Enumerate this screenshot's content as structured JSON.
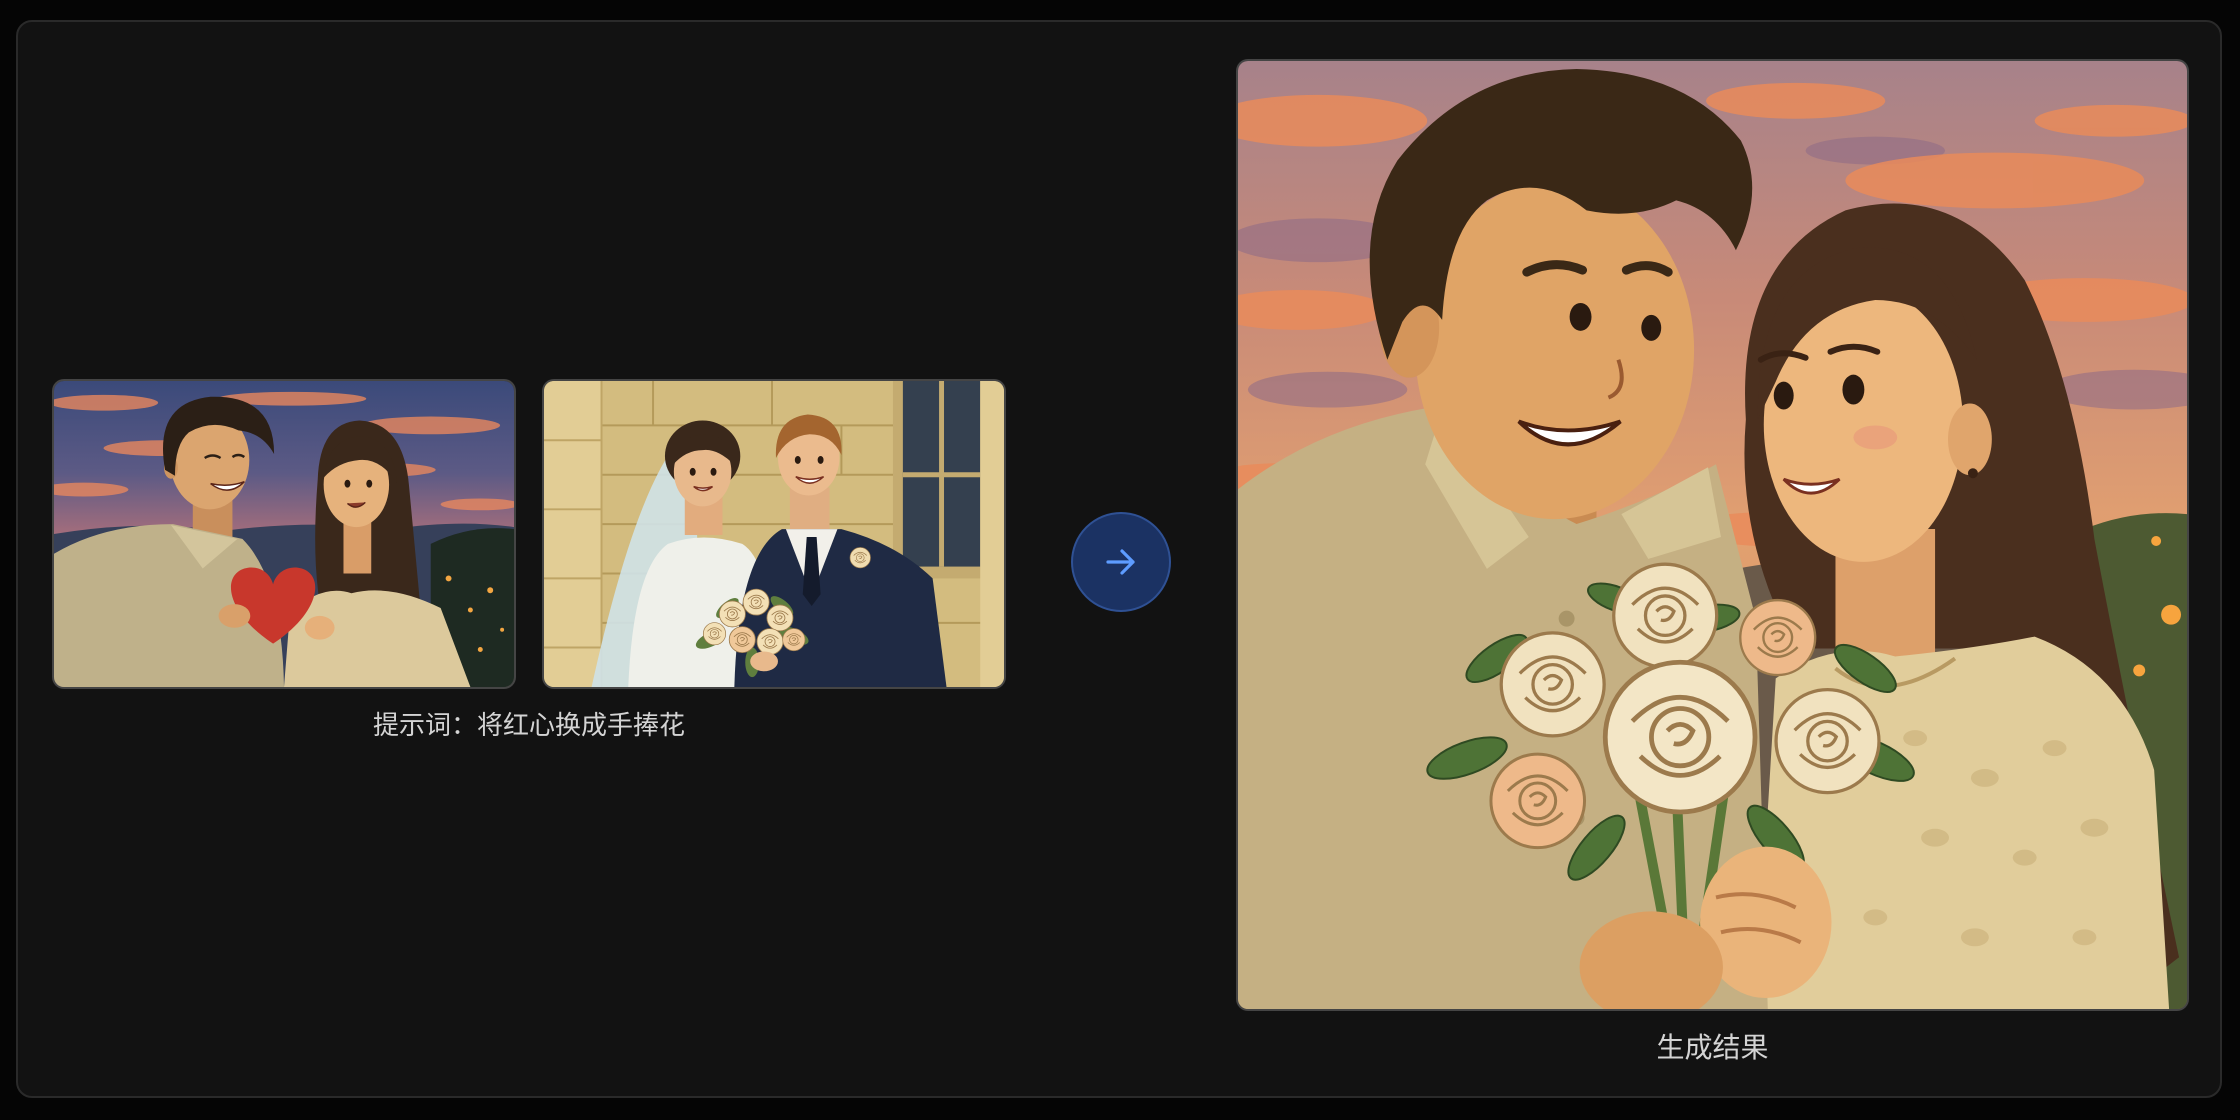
{
  "prompt": {
    "label": "提示词：",
    "text": "将红心换成手捧花"
  },
  "result": {
    "label": "生成结果"
  },
  "icons": {
    "transition": "arrow-right-icon"
  },
  "colors": {
    "page_background": "#050505",
    "panel_background": "#121212",
    "panel_border": "#2a2a2a",
    "arrow_circle_fill": "#1b3263",
    "arrow_circle_border": "#2f5194",
    "arrow_icon": "#5e9cff",
    "caption_text": "#d4d4d4"
  }
}
